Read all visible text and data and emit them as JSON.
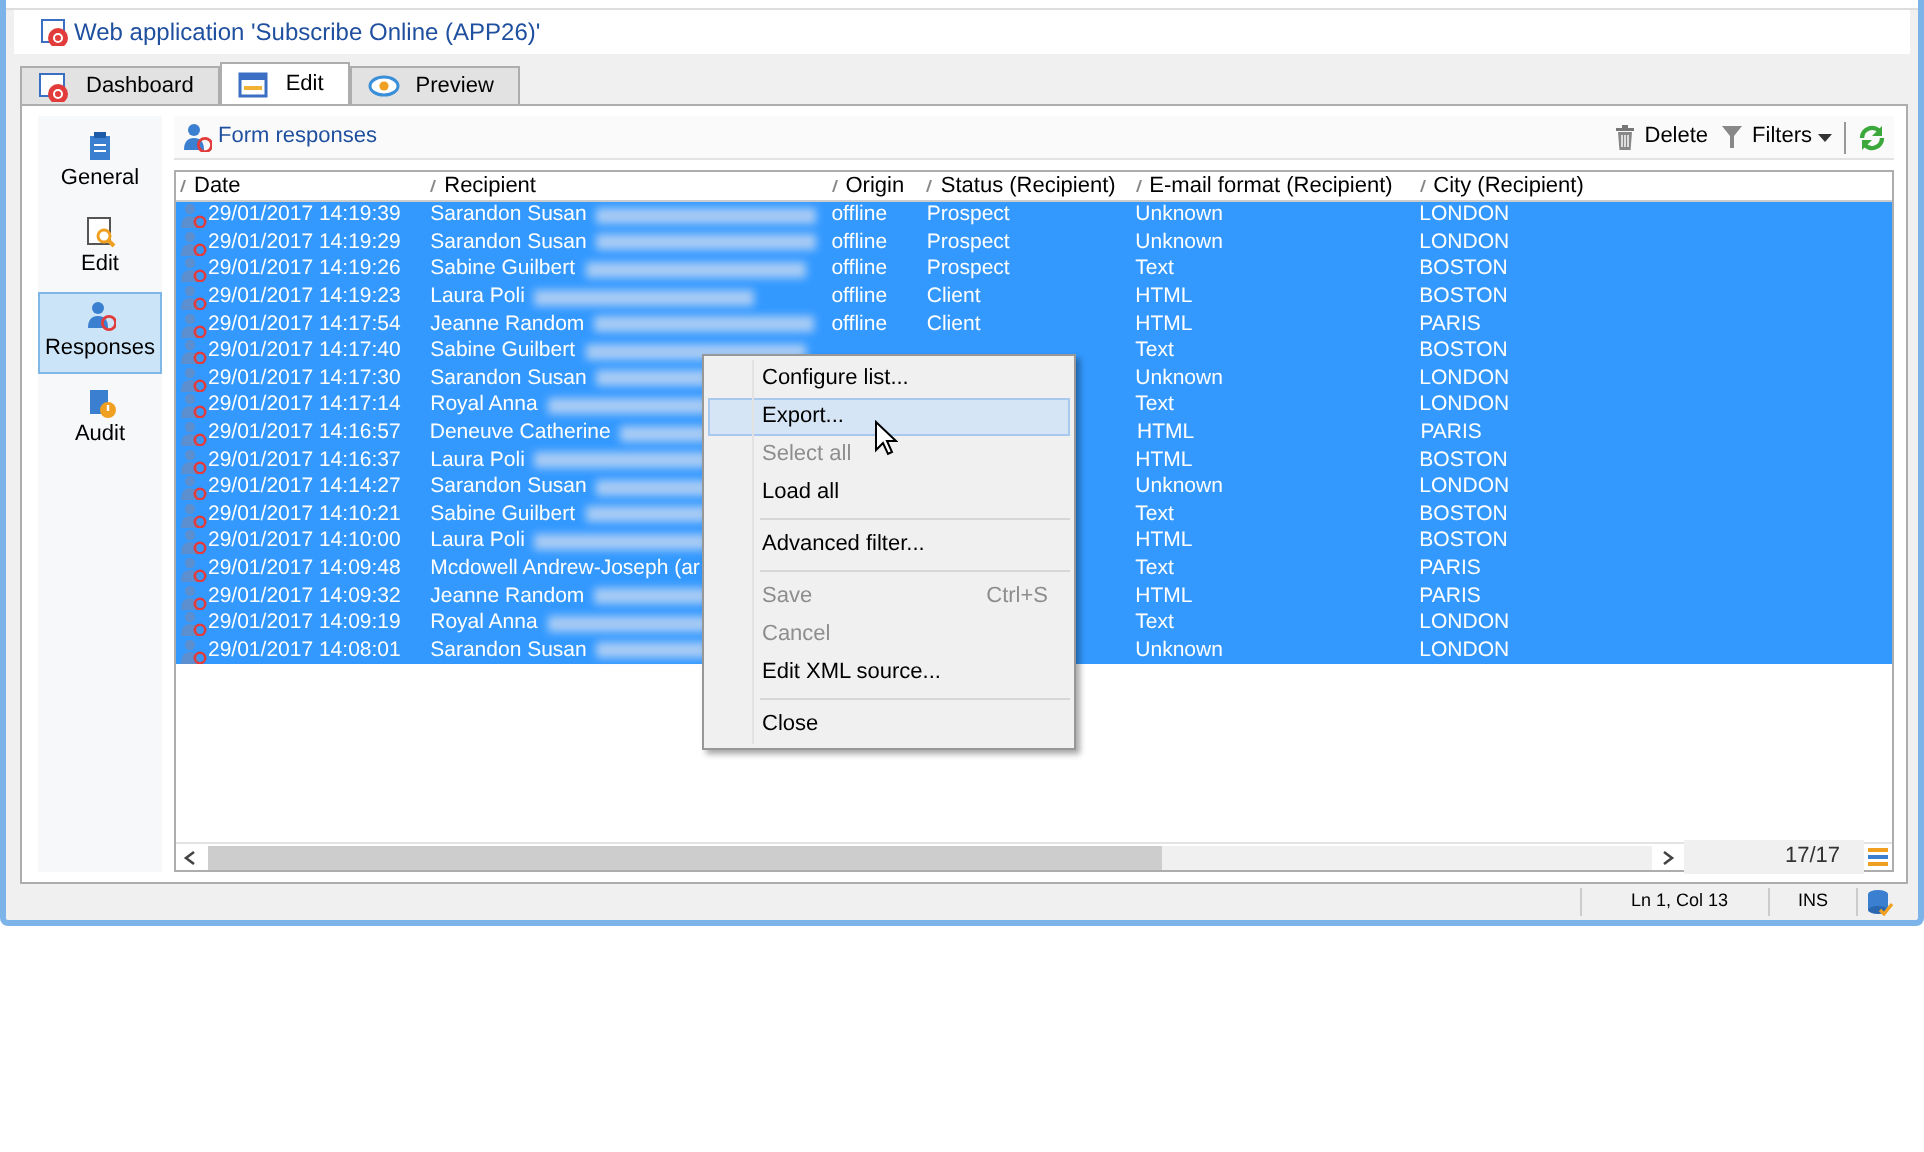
{
  "window": {
    "title": "Web application 'Subscribe Online (APP26)'"
  },
  "tabs": [
    {
      "label": "Dashboard",
      "selected": false
    },
    {
      "label": "Edit",
      "selected": true
    },
    {
      "label": "Preview",
      "selected": false
    }
  ],
  "sidebar": {
    "items": [
      {
        "label": "General",
        "selected": false
      },
      {
        "label": "Edit",
        "selected": false
      },
      {
        "label": "Responses",
        "selected": true
      },
      {
        "label": "Audit",
        "selected": false
      }
    ]
  },
  "toolbar": {
    "title": "Form responses",
    "actions": [
      {
        "label": "Delete",
        "dropdown": false
      },
      {
        "label": "Filters",
        "dropdown": true
      }
    ]
  },
  "table": {
    "columns": [
      "Date",
      "Recipient",
      "Origin",
      "Status (Recipient)",
      "E-mail format (Recipient)",
      "City (Recipient)"
    ],
    "rows": [
      {
        "selected": true,
        "redacted": true,
        "cells": [
          "29/01/2017 14:19:39",
          "Sarandon Susan",
          "offline",
          "Prospect",
          "Unknown",
          "LONDON"
        ]
      },
      {
        "selected": true,
        "redacted": true,
        "cells": [
          "29/01/2017 14:19:29",
          "Sarandon Susan",
          "offline",
          "Prospect",
          "Unknown",
          "LONDON"
        ]
      },
      {
        "selected": true,
        "redacted": true,
        "cells": [
          "29/01/2017 14:19:26",
          "Sabine Guilbert",
          "offline",
          "Prospect",
          "Text",
          "BOSTON"
        ]
      },
      {
        "selected": true,
        "redacted": true,
        "cells": [
          "29/01/2017 14:19:23",
          "Laura Poli",
          "offline",
          "Client",
          "HTML",
          "BOSTON"
        ]
      },
      {
        "selected": true,
        "redacted": true,
        "cells": [
          "29/01/2017 14:17:54",
          "Jeanne Random",
          "offline",
          "Client",
          "HTML",
          "PARIS"
        ]
      },
      {
        "selected": true,
        "redacted": true,
        "cells": [
          "29/01/2017 14:17:40",
          "Sabine Guilbert",
          null,
          null,
          "Text",
          "BOSTON"
        ]
      },
      {
        "selected": true,
        "redacted": true,
        "cells": [
          "29/01/2017 14:17:30",
          "Sarandon Susan",
          null,
          null,
          "Unknown",
          "LONDON"
        ]
      },
      {
        "selected": true,
        "redacted": true,
        "cells": [
          "29/01/2017 14:17:14",
          "Royal Anna",
          null,
          null,
          "Text",
          "LONDON"
        ]
      },
      {
        "selected": true,
        "redacted": true,
        "cells": [
          "29/01/2017 14:16:57",
          "Deneuve Catherine",
          null,
          null,
          "HTML",
          "PARIS"
        ]
      },
      {
        "selected": true,
        "redacted": true,
        "cells": [
          "29/01/2017 14:16:37",
          "Laura Poli",
          null,
          null,
          "HTML",
          "BOSTON"
        ]
      },
      {
        "selected": true,
        "redacted": true,
        "cells": [
          "29/01/2017 14:14:27",
          "Sarandon Susan",
          null,
          null,
          "Unknown",
          "LONDON"
        ]
      },
      {
        "selected": true,
        "redacted": true,
        "cells": [
          "29/01/2017 14:10:21",
          "Sabine Guilbert",
          null,
          null,
          "Text",
          "BOSTON"
        ]
      },
      {
        "selected": true,
        "redacted": true,
        "cells": [
          "29/01/2017 14:10:00",
          "Laura Poli",
          null,
          null,
          "HTML",
          "BOSTON"
        ]
      },
      {
        "selected": true,
        "redacted": false,
        "cells": [
          "29/01/2017 14:09:48",
          "Mcdowell Andrew-Joseph (ar",
          null,
          null,
          "Text",
          "PARIS"
        ]
      },
      {
        "selected": true,
        "redacted": true,
        "cells": [
          "29/01/2017 14:09:32",
          "Jeanne Random",
          null,
          null,
          "HTML",
          "PARIS"
        ]
      },
      {
        "selected": true,
        "redacted": true,
        "cells": [
          "29/01/2017 14:09:19",
          "Royal Anna",
          null,
          null,
          "Text",
          "LONDON"
        ]
      },
      {
        "selected": true,
        "redacted": true,
        "cells": [
          "29/01/2017 14:08:01",
          "Sarandon Susan",
          null,
          null,
          "Unknown",
          "LONDON"
        ]
      }
    ],
    "count": "17/17"
  },
  "context_menu": {
    "items": [
      {
        "kind": "item",
        "label": "Configure list...",
        "disabled": false,
        "selected": false
      },
      {
        "kind": "item",
        "label": "Export...",
        "disabled": false,
        "selected": true
      },
      {
        "kind": "item",
        "label": "Select all",
        "disabled": true,
        "selected": false
      },
      {
        "kind": "item",
        "label": "Load all",
        "disabled": false,
        "selected": false
      },
      {
        "kind": "separator"
      },
      {
        "kind": "item",
        "label": "Advanced filter...",
        "disabled": false,
        "selected": false
      },
      {
        "kind": "separator"
      },
      {
        "kind": "item",
        "label": "Save",
        "shortcut": "Ctrl+S",
        "disabled": true,
        "selected": false
      },
      {
        "kind": "item",
        "label": "Cancel",
        "disabled": true,
        "selected": false
      },
      {
        "kind": "item",
        "label": "Edit XML source...",
        "disabled": false,
        "selected": false
      },
      {
        "kind": "separator"
      },
      {
        "kind": "item",
        "label": "Close",
        "disabled": false,
        "selected": false
      }
    ]
  },
  "status_bar": {
    "position": "Ln 1, Col 13",
    "mode": "INS"
  }
}
